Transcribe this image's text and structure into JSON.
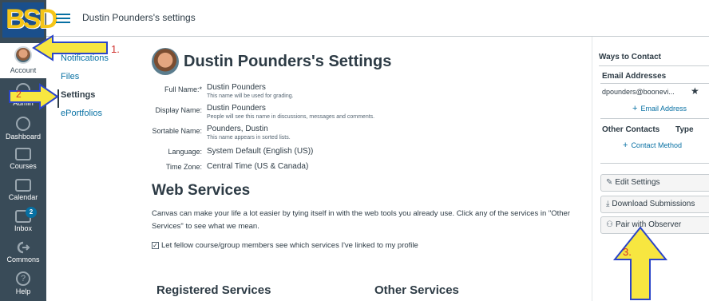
{
  "logo": {
    "text": "BSD"
  },
  "global_nav": {
    "items": [
      {
        "label": "Account",
        "icon": "avatar"
      },
      {
        "label": "Admin",
        "icon": "shield-icon"
      },
      {
        "label": "Dashboard",
        "icon": "dashboard-icon"
      },
      {
        "label": "Courses",
        "icon": "book-icon"
      },
      {
        "label": "Calendar",
        "icon": "calendar-icon"
      },
      {
        "label": "Inbox",
        "icon": "inbox-icon",
        "badge": "2"
      },
      {
        "label": "Commons",
        "icon": "commons-icon"
      },
      {
        "label": "Help",
        "icon": "help-icon"
      }
    ]
  },
  "header": {
    "breadcrumb": "Dustin Pounders's settings"
  },
  "subnav": {
    "items": [
      {
        "label": "Notifications"
      },
      {
        "label": "Files"
      },
      {
        "label": "Settings"
      },
      {
        "label": "ePortfolios"
      }
    ]
  },
  "profile": {
    "title": "Dustin Pounders's Settings",
    "fields": [
      {
        "label": "Full Name:*",
        "value": "Dustin Pounders",
        "hint": "This name will be used for grading."
      },
      {
        "label": "Display Name:",
        "value": "Dustin Pounders",
        "hint": "People will see this name in discussions, messages and comments."
      },
      {
        "label": "Sortable Name:",
        "value": "Pounders, Dustin",
        "hint": "This name appears in sorted lists."
      },
      {
        "label": "Language:",
        "value": "System Default (English (US))"
      },
      {
        "label": "Time Zone:",
        "value": "Central Time (US & Canada)"
      }
    ]
  },
  "web_services": {
    "title": "Web Services",
    "description": "Canvas can make your life a lot easier by tying itself in with the web tools you already use. Click any of the services in \"Other Services\" to see what we mean.",
    "checkbox_label": "Let fellow course/group members see which services I've linked to my profile",
    "registered_title": "Registered Services",
    "other_title": "Other Services"
  },
  "contact": {
    "title": "Ways to Contact",
    "email_heading": "Email Addresses",
    "email": "dpounders@boonevi...",
    "add_email": "Email Address",
    "other_heading": "Other Contacts",
    "type_heading": "Type",
    "add_contact": "Contact Method"
  },
  "actions": {
    "edit": "Edit Settings",
    "download": "Download Submissions",
    "observer": "Pair with Observer"
  },
  "annotations": {
    "step1": "1.",
    "step2": "2",
    "step3": "3."
  },
  "colors": {
    "nav_bg": "#394b58",
    "link": "#0770a3",
    "arrow_fill": "#f7e640",
    "arrow_stroke": "#2b45c9",
    "annotation_text": "#d0312d"
  }
}
